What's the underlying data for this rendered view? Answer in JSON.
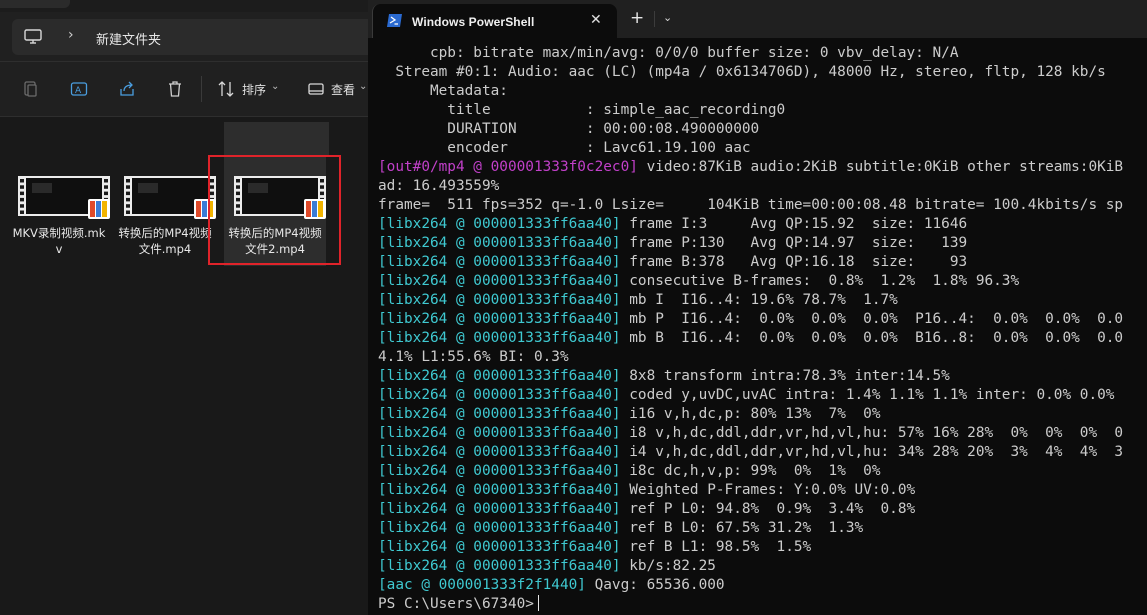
{
  "explorer": {
    "breadcrumb": "新建文件夹",
    "toolbar": {
      "sort_label": "排序",
      "view_label": "查看"
    },
    "files": [
      {
        "name": "MKV录制视频.mkv"
      },
      {
        "name": "转换后的MP4视频文件.mp4"
      },
      {
        "name": "转换后的MP4视频文件2.mp4"
      }
    ]
  },
  "terminal": {
    "tab_title": "Windows PowerShell",
    "close_glyph": "✕",
    "new_tab_glyph": "+",
    "dropdown_glyph": "⌄",
    "lines": [
      {
        "tag": "",
        "text": "      cpb: bitrate max/min/avg: 0/0/0 buffer size: 0 vbv_delay: N/A"
      },
      {
        "tag": "",
        "text": "  Stream #0:1: Audio: aac (LC) (mp4a / 0x6134706D), 48000 Hz, stereo, fltp, 128 kb/s"
      },
      {
        "tag": "",
        "text": "      Metadata:"
      },
      {
        "tag": "",
        "text": "        title           : simple_aac_recording0"
      },
      {
        "tag": "",
        "text": "        DURATION        : 00:00:08.490000000"
      },
      {
        "tag": "",
        "text": "        encoder         : Lavc61.19.100 aac"
      },
      {
        "tag": "[out#0/mp4 @ 000001333f0c2ec0]",
        "tagcolor": "mag",
        "text": " video:87KiB audio:2KiB subtitle:0KiB other streams:0KiB"
      },
      {
        "tag": "",
        "text": "ad: 16.493559%"
      },
      {
        "tag": "",
        "text": "frame=  511 fps=352 q=-1.0 Lsize=     104KiB time=00:00:08.48 bitrate= 100.4kbits/s sp"
      },
      {
        "tag": "[libx264 @ 000001333ff6aa40]",
        "tagcolor": "blue",
        "text": " frame I:3     Avg QP:15.92  size: 11646"
      },
      {
        "tag": "[libx264 @ 000001333ff6aa40]",
        "tagcolor": "blue",
        "text": " frame P:130   Avg QP:14.97  size:   139"
      },
      {
        "tag": "[libx264 @ 000001333ff6aa40]",
        "tagcolor": "blue",
        "text": " frame B:378   Avg QP:16.18  size:    93"
      },
      {
        "tag": "[libx264 @ 000001333ff6aa40]",
        "tagcolor": "blue",
        "text": " consecutive B-frames:  0.8%  1.2%  1.8% 96.3%"
      },
      {
        "tag": "[libx264 @ 000001333ff6aa40]",
        "tagcolor": "blue",
        "text": " mb I  I16..4: 19.6% 78.7%  1.7%"
      },
      {
        "tag": "[libx264 @ 000001333ff6aa40]",
        "tagcolor": "blue",
        "text": " mb P  I16..4:  0.0%  0.0%  0.0%  P16..4:  0.0%  0.0%  0.0"
      },
      {
        "tag": "[libx264 @ 000001333ff6aa40]",
        "tagcolor": "blue",
        "text": " mb B  I16..4:  0.0%  0.0%  0.0%  B16..8:  0.0%  0.0%  0.0"
      },
      {
        "tag": "",
        "text": "4.1% L1:55.6% BI: 0.3%"
      },
      {
        "tag": "[libx264 @ 000001333ff6aa40]",
        "tagcolor": "blue",
        "text": " 8x8 transform intra:78.3% inter:14.5%"
      },
      {
        "tag": "[libx264 @ 000001333ff6aa40]",
        "tagcolor": "blue",
        "text": " coded y,uvDC,uvAC intra: 1.4% 1.1% 1.1% inter: 0.0% 0.0%"
      },
      {
        "tag": "[libx264 @ 000001333ff6aa40]",
        "tagcolor": "blue",
        "text": " i16 v,h,dc,p: 80% 13%  7%  0%"
      },
      {
        "tag": "[libx264 @ 000001333ff6aa40]",
        "tagcolor": "blue",
        "text": " i8 v,h,dc,ddl,ddr,vr,hd,vl,hu: 57% 16% 28%  0%  0%  0%  0"
      },
      {
        "tag": "[libx264 @ 000001333ff6aa40]",
        "tagcolor": "blue",
        "text": " i4 v,h,dc,ddl,ddr,vr,hd,vl,hu: 34% 28% 20%  3%  4%  4%  3"
      },
      {
        "tag": "[libx264 @ 000001333ff6aa40]",
        "tagcolor": "blue",
        "text": " i8c dc,h,v,p: 99%  0%  1%  0%"
      },
      {
        "tag": "[libx264 @ 000001333ff6aa40]",
        "tagcolor": "blue",
        "text": " Weighted P-Frames: Y:0.0% UV:0.0%"
      },
      {
        "tag": "[libx264 @ 000001333ff6aa40]",
        "tagcolor": "blue",
        "text": " ref P L0: 94.8%  0.9%  3.4%  0.8%"
      },
      {
        "tag": "[libx264 @ 000001333ff6aa40]",
        "tagcolor": "blue",
        "text": " ref B L0: 67.5% 31.2%  1.3%"
      },
      {
        "tag": "[libx264 @ 000001333ff6aa40]",
        "tagcolor": "blue",
        "text": " ref B L1: 98.5%  1.5%"
      },
      {
        "tag": "[libx264 @ 000001333ff6aa40]",
        "tagcolor": "blue",
        "text": " kb/s:82.25"
      },
      {
        "tag": "[aac @ 000001333f2f1440]",
        "tagcolor": "blue",
        "text": " Qavg: 65536.000"
      }
    ],
    "prompt": "PS C:\\Users\\67340>"
  },
  "colors": {
    "explorer_bg": "#191919",
    "terminal_bg": "#0c0c0c",
    "terminal_text": "#cccccc",
    "tag_cyan": "#3fc9d1",
    "tag_magenta": "#c140c9",
    "selection_outline": "#e0232a"
  },
  "icons": [
    "computer-icon",
    "chevron-right-icon",
    "copy-icon",
    "rename-icon",
    "share-icon",
    "delete-icon",
    "sort-icon",
    "view-icon",
    "video-file-icon",
    "powershell-icon",
    "close-icon",
    "plus-icon",
    "chevron-down-icon"
  ]
}
